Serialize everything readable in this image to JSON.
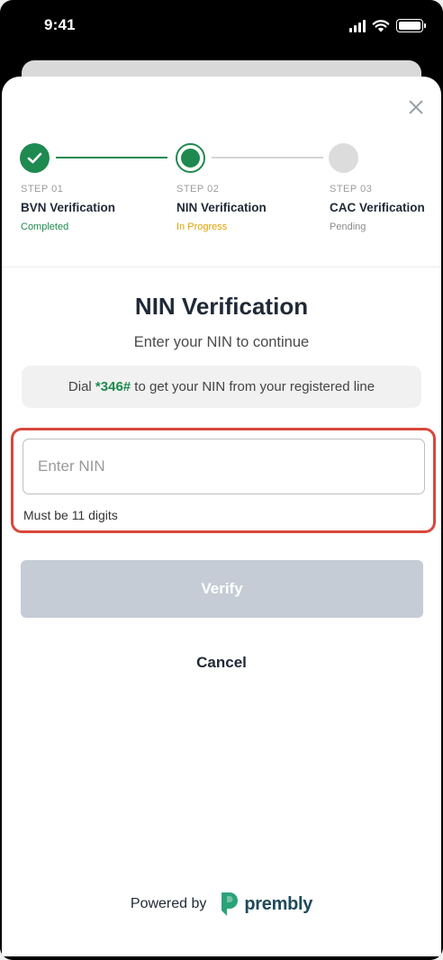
{
  "status_bar": {
    "time": "9:41"
  },
  "stepper": {
    "steps": [
      {
        "num": "STEP 01",
        "name": "BVN Verification",
        "status": "Completed"
      },
      {
        "num": "STEP 02",
        "name": "NIN Verification",
        "status": "In Progress"
      },
      {
        "num": "STEP 03",
        "name": "CAC Verification",
        "status": "Pending"
      }
    ]
  },
  "main": {
    "title": "NIN Verification",
    "subtitle": "Enter your NIN to continue",
    "hint": {
      "prefix": "Dial ",
      "code": "*346#",
      "suffix": " to get your NIN from your registered line"
    },
    "nin_field": {
      "value": "",
      "placeholder": "Enter NIN",
      "helper": "Must be 11 digits"
    },
    "verify_label": "Verify",
    "cancel_label": "Cancel"
  },
  "footer": {
    "powered_by": "Powered by",
    "brand": "prembly"
  },
  "colors": {
    "accent": "#1e8a4f",
    "in_progress": "#e0a100",
    "highlight_border": "#d9473b",
    "disabled_button": "#c6ccd6"
  }
}
